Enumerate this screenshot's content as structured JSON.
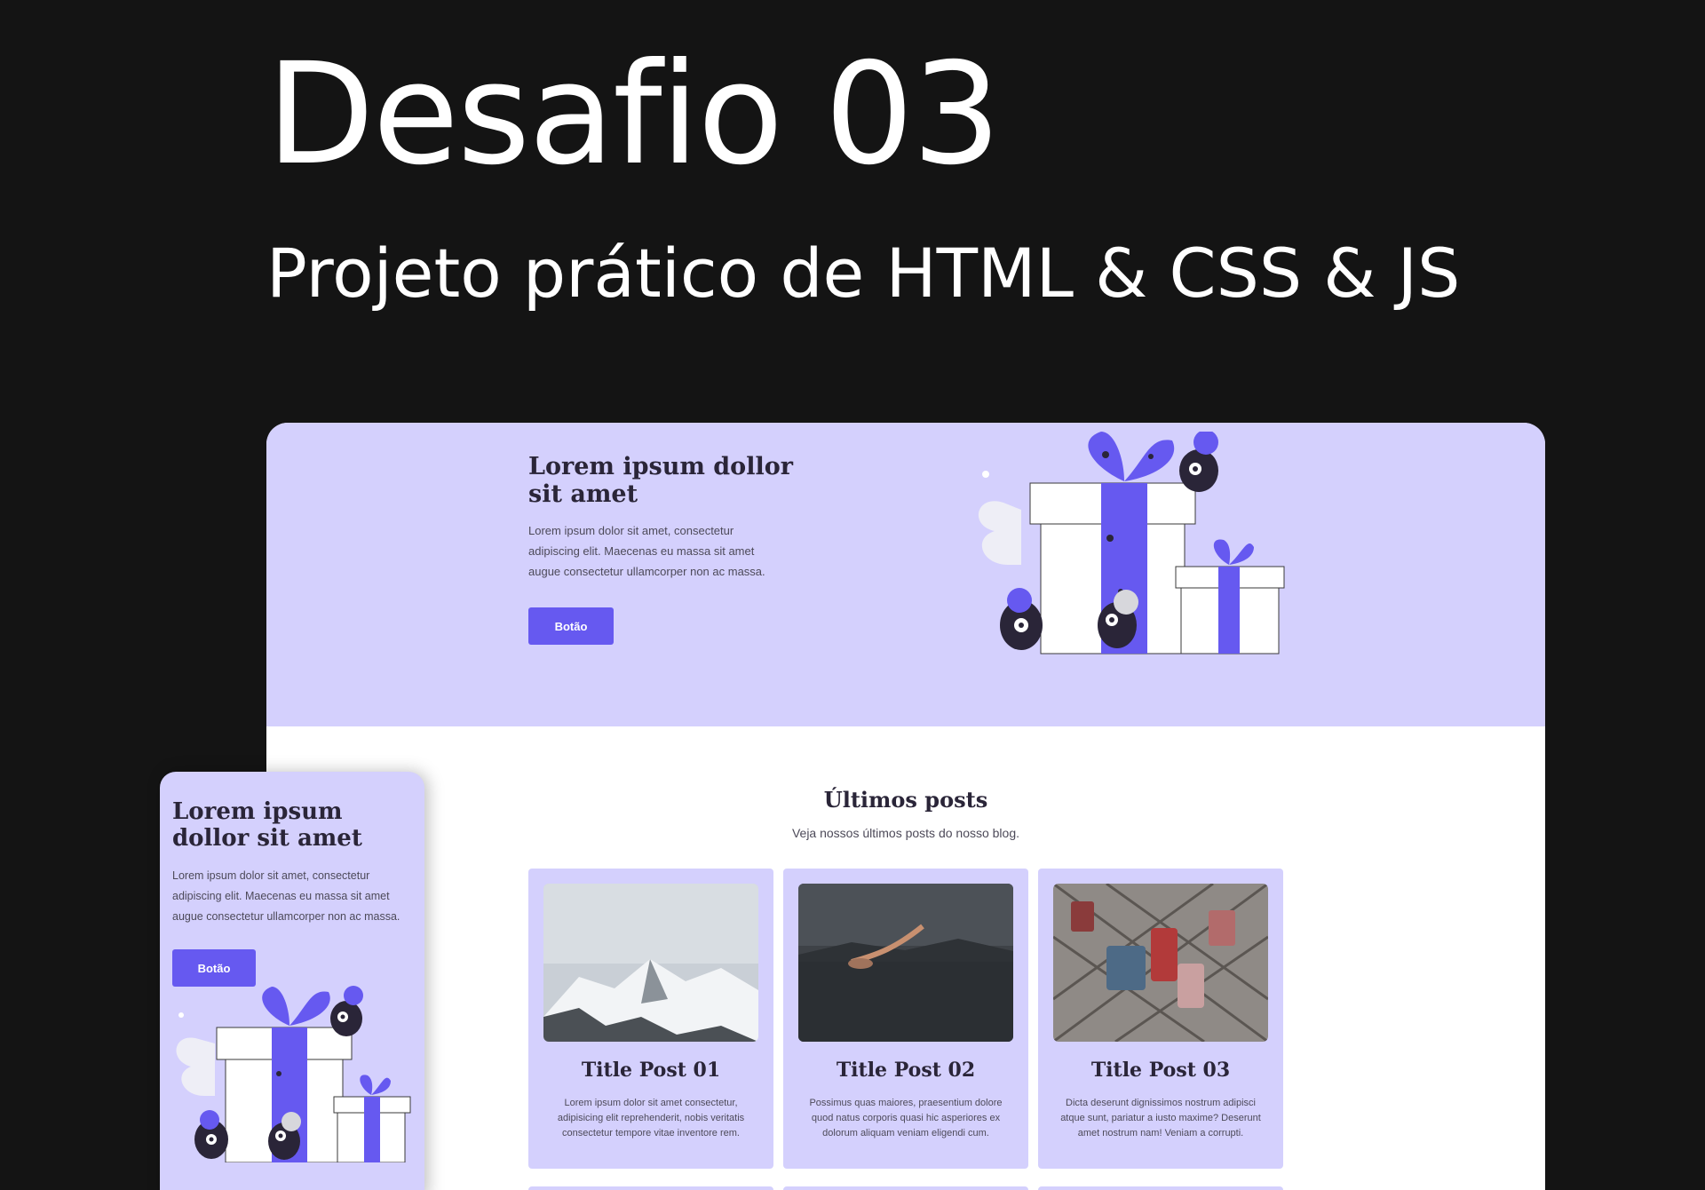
{
  "page": {
    "title": "Desafio 03",
    "subtitle": "Projeto prático de HTML & CSS & JS"
  },
  "desktop": {
    "hero": {
      "title": "Lorem ipsum dollor sit amet",
      "text": "Lorem ipsum dolor sit amet, consectetur adipiscing elit. Maecenas eu massa sit amet augue consectetur ullamcorper non ac massa.",
      "button_label": "Botão",
      "illustration_icon": "gift-boxes-monsters-illustration"
    },
    "posts": {
      "title": "Últimos posts",
      "subtitle": "Veja nossos últimos posts do nosso blog.",
      "cards": [
        {
          "title": "Title Post 01",
          "text": "Lorem ipsum dolor sit amet consectetur, adipisicing elit reprehenderit, nobis veritatis consectetur tempore vitae inventore rem.",
          "image": "snowy-mountains-photo"
        },
        {
          "title": "Title Post 02",
          "text": "Possimus quas maiores, praesentium dolore quod natus corporis quasi hic asperiores ex dolorum aliquam veniam eligendi cum.",
          "image": "swimmer-lake-photo"
        },
        {
          "title": "Title Post 03",
          "text": "Dicta deserunt dignissimos nostrum adipisci atque sunt, pariatur a iusto maxime? Deserunt amet nostrum nam! Veniam a corrupti.",
          "image": "love-padlocks-photo"
        }
      ]
    }
  },
  "mobile": {
    "hero": {
      "title": "Lorem ipsum dollor sit amet",
      "text": "Lorem ipsum dolor sit amet, consectetur adipiscing elit. Maecenas eu massa sit amet augue consectetur ullamcorper non ac massa.",
      "button_label": "Botão",
      "illustration_icon": "gift-boxes-monsters-illustration"
    }
  },
  "colors": {
    "background": "#141414",
    "lavender": "#d4d0fd",
    "accent": "#6659f0",
    "monster": "#2a2538",
    "text_dark": "#2a2538"
  }
}
